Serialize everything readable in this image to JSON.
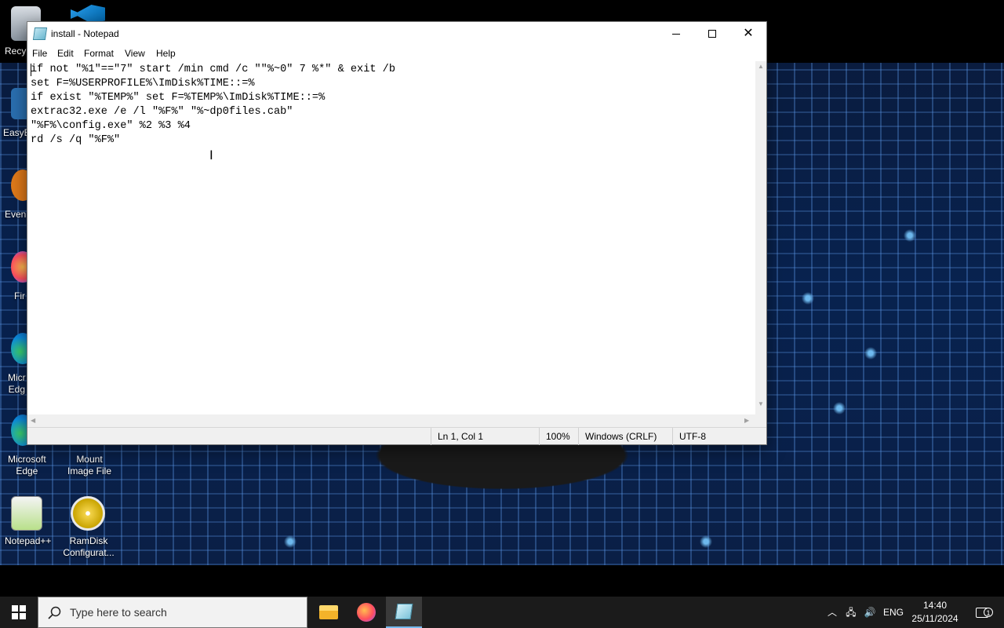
{
  "desktop": {
    "icons": [
      {
        "label": "Recy",
        "icon": "recycle-bin-icon"
      },
      {
        "label": "EasyB",
        "icon": "app-icon"
      },
      {
        "label": "Even",
        "icon": "app-icon"
      },
      {
        "label": "Fir",
        "icon": "firefox-icon"
      },
      {
        "label": "Micr\nEdg",
        "icon": "edge-icon"
      },
      {
        "label": "Microsoft\nEdge",
        "icon": "edge-icon"
      },
      {
        "label": "Mount\nImage File",
        "icon": "disc-icon"
      },
      {
        "label": "Notepad++",
        "icon": "notepad-plus-plus-icon"
      },
      {
        "label": "RamDisk\nConfigurat...",
        "icon": "ramdisk-icon"
      }
    ]
  },
  "notepad": {
    "title": "install - Notepad",
    "menu": [
      "File",
      "Edit",
      "Format",
      "View",
      "Help"
    ],
    "content": "if not \"%1\"==\"7\" start /min cmd /c \"\"%~0\" 7 %*\" & exit /b\nset F=%USERPROFILE%\\ImDisk%TIME::=%\nif exist \"%TEMP%\" set F=%TEMP%\\ImDisk%TIME::=%\nextrac32.exe /e /l \"%F%\" \"%~dp0files.cab\"\n\"%F%\\config.exe\" %2 %3 %4\nrd /s /q \"%F%\"",
    "status": {
      "position": "Ln 1, Col 1",
      "zoom": "100%",
      "line_ending": "Windows (CRLF)",
      "encoding": "UTF-8"
    }
  },
  "taskbar": {
    "search_placeholder": "Type here to search",
    "language": "ENG",
    "time": "14:40",
    "date": "25/11/2024",
    "notification_count": "1"
  }
}
